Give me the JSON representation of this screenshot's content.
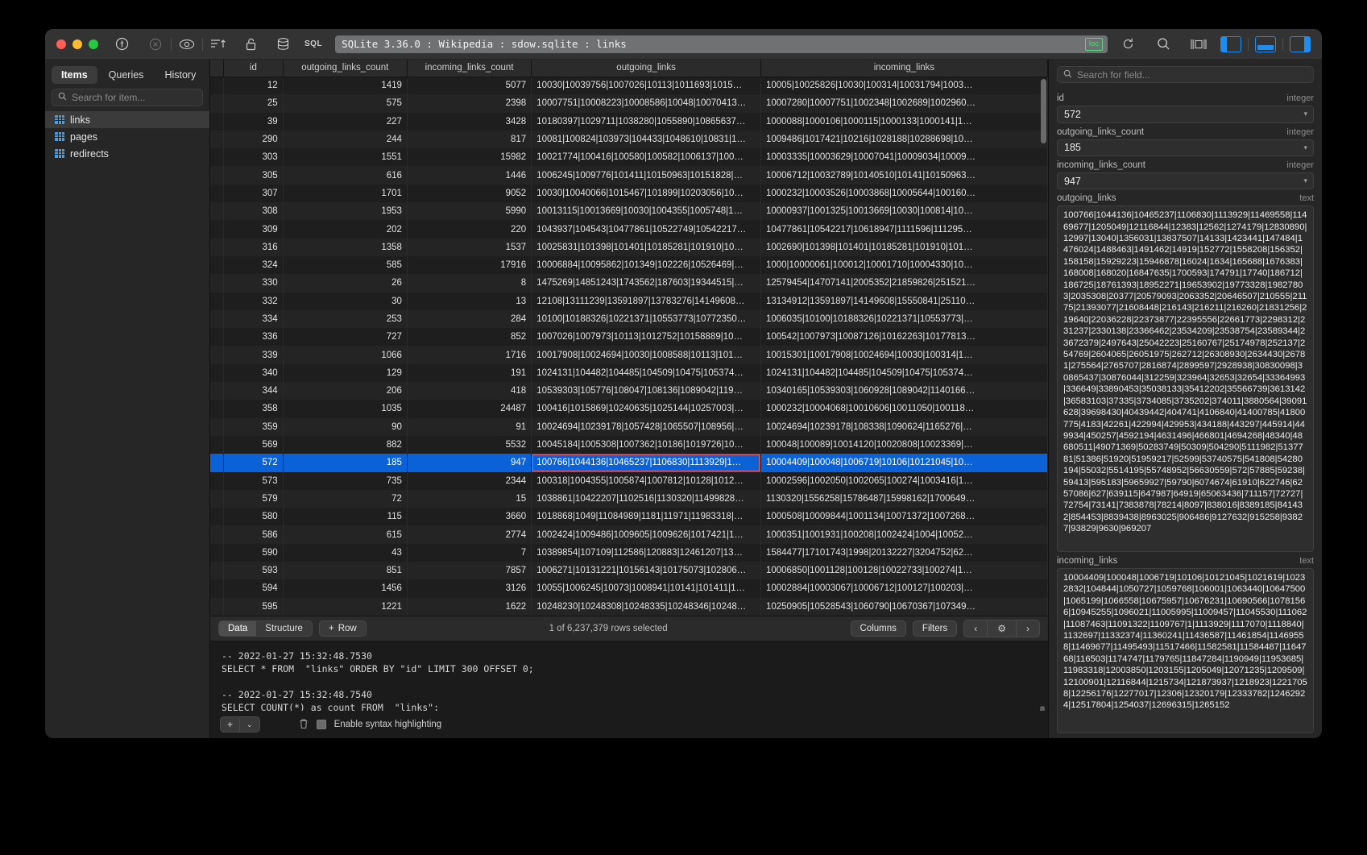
{
  "titlebar": {
    "path": "SQLite 3.36.0 : Wikipedia : sdow.sqlite : links",
    "sql_label": "SQL",
    "loc_badge": "loc",
    "icons": {
      "plug": "plug-icon",
      "stop": "stop-icon",
      "eye": "eye-icon",
      "sort": "sort-ascending-icon",
      "lock": "unlock-icon",
      "database": "database-icon",
      "refresh": "refresh-icon",
      "search": "search-icon",
      "panel": "center-panel-icon",
      "left_panel": "left-panel-icon",
      "bottom_panel": "bottom-panel-icon",
      "right_panel": "right-panel-icon"
    }
  },
  "sidebar": {
    "tabs": [
      {
        "label": "Items",
        "active": true
      },
      {
        "label": "Queries",
        "active": false
      },
      {
        "label": "History",
        "active": false
      }
    ],
    "search_placeholder": "Search for item...",
    "search_value": "",
    "items": [
      {
        "label": "links",
        "selected": true
      },
      {
        "label": "pages",
        "selected": false
      },
      {
        "label": "redirects",
        "selected": false
      }
    ]
  },
  "grid": {
    "columns": [
      "id",
      "outgoing_links_count",
      "incoming_links_count",
      "outgoing_links",
      "incoming_links"
    ],
    "rows": [
      {
        "id": "12",
        "olc": "1419",
        "ilc": "5077",
        "ol": "10030|10039756|1007026|10113|1011693|1015…",
        "il": "10005|10025826|10030|100314|10031794|1003…",
        "selected": false
      },
      {
        "id": "25",
        "olc": "575",
        "ilc": "2398",
        "ol": "10007751|10008223|10008586|10048|10070413…",
        "il": "10007280|10007751|1002348|1002689|1002960…",
        "selected": false
      },
      {
        "id": "39",
        "olc": "227",
        "ilc": "3428",
        "ol": "10180397|1029711|1038280|1055890|10865637…",
        "il": "1000088|1000106|1000115|1000133|1000141|1…",
        "selected": false
      },
      {
        "id": "290",
        "olc": "244",
        "ilc": "817",
        "ol": "10081|100824|103973|104433|1048610|10831|1…",
        "il": "1009486|1017421|10216|1028188|10288698|10…",
        "selected": false
      },
      {
        "id": "303",
        "olc": "1551",
        "ilc": "15982",
        "ol": "10021774|100416|100580|100582|1006137|100…",
        "il": "10003335|10003629|10007041|10009034|10009…",
        "selected": false
      },
      {
        "id": "305",
        "olc": "616",
        "ilc": "1446",
        "ol": "1006245|1009776|101411|10150963|10151828|…",
        "il": "10006712|10032789|10140510|10141|10150963…",
        "selected": false
      },
      {
        "id": "307",
        "olc": "1701",
        "ilc": "9052",
        "ol": "10030|10040066|1015467|101899|10203056|10…",
        "il": "1000232|10003526|10003868|10005644|100160…",
        "selected": false
      },
      {
        "id": "308",
        "olc": "1953",
        "ilc": "5990",
        "ol": "10013115|10013669|10030|1004355|1005748|1…",
        "il": "10000937|1001325|10013669|10030|100814|10…",
        "selected": false
      },
      {
        "id": "309",
        "olc": "202",
        "ilc": "220",
        "ol": "1043937|104543|10477861|10522749|10542217…",
        "il": "10477861|10542217|10618947|1111596|111295…",
        "selected": false
      },
      {
        "id": "316",
        "olc": "1358",
        "ilc": "1537",
        "ol": "10025831|101398|101401|10185281|101910|10…",
        "il": "1002690|101398|101401|10185281|101910|101…",
        "selected": false
      },
      {
        "id": "324",
        "olc": "585",
        "ilc": "17916",
        "ol": "10006884|10095862|101349|102226|10526469|…",
        "il": "1000|10000061|100012|10001710|10004330|10…",
        "selected": false
      },
      {
        "id": "330",
        "olc": "26",
        "ilc": "8",
        "ol": "1475269|14851243|1743562|187603|19344515|…",
        "il": "12579454|14707141|2005352|21859826|251521…",
        "selected": false
      },
      {
        "id": "332",
        "olc": "30",
        "ilc": "13",
        "ol": "12108|13111239|13591897|13783276|14149608…",
        "il": "13134912|13591897|14149608|15550841|25110…",
        "selected": false
      },
      {
        "id": "334",
        "olc": "253",
        "ilc": "284",
        "ol": "10100|10188326|10221371|10553773|10772350…",
        "il": "1006035|10100|10188326|10221371|10553773|…",
        "selected": false
      },
      {
        "id": "336",
        "olc": "727",
        "ilc": "852",
        "ol": "1007026|1007973|10113|1012752|10158889|10…",
        "il": "100542|1007973|10087126|10162263|10177813…",
        "selected": false
      },
      {
        "id": "339",
        "olc": "1066",
        "ilc": "1716",
        "ol": "10017908|10024694|10030|1008588|10113|101…",
        "il": "10015301|10017908|10024694|10030|100314|1…",
        "selected": false
      },
      {
        "id": "340",
        "olc": "129",
        "ilc": "191",
        "ol": "1024131|104482|104485|104509|10475|105374…",
        "il": "1024131|104482|104485|104509|10475|105374…",
        "selected": false
      },
      {
        "id": "344",
        "olc": "206",
        "ilc": "418",
        "ol": "10539303|105776|108047|108136|1089042|119…",
        "il": "10340165|10539303|1060928|1089042|1140166…",
        "selected": false
      },
      {
        "id": "358",
        "olc": "1035",
        "ilc": "24487",
        "ol": "100416|1015869|10240635|1025144|10257003|…",
        "il": "1000232|10004068|10010606|10011050|100118…",
        "selected": false
      },
      {
        "id": "359",
        "olc": "90",
        "ilc": "91",
        "ol": "10024694|10239178|1057428|1065507|108956|…",
        "il": "10024694|10239178|108338|1090624|1165276|…",
        "selected": false
      },
      {
        "id": "569",
        "olc": "882",
        "ilc": "5532",
        "ol": "10045184|1005308|1007362|10186|1019726|10…",
        "il": "100048|100089|10014120|10020808|10023369|…",
        "selected": false
      },
      {
        "id": "572",
        "olc": "185",
        "ilc": "947",
        "ol": "100766|1044136|10465237|1106830|1113929|1…",
        "il": "10004409|100048|1006719|10106|10121045|10…",
        "selected": true
      },
      {
        "id": "573",
        "olc": "735",
        "ilc": "2344",
        "ol": "100318|1004355|1005874|1007812|10128|1012…",
        "il": "10002596|1002050|1002065|100274|1003416|1…",
        "selected": false
      },
      {
        "id": "579",
        "olc": "72",
        "ilc": "15",
        "ol": "1038861|10422207|1102516|1130320|11499828…",
        "il": "1130320|1556258|15786487|15998162|1700649…",
        "selected": false
      },
      {
        "id": "580",
        "olc": "115",
        "ilc": "3660",
        "ol": "1018868|1049|11084989|1181|11971|11983318|…",
        "il": "1000508|10009844|1001134|10071372|1007268…",
        "selected": false
      },
      {
        "id": "586",
        "olc": "615",
        "ilc": "2774",
        "ol": "1002424|1009486|1009605|1009626|1017421|1…",
        "il": "1000351|1001931|100208|1002424|1004|10052…",
        "selected": false
      },
      {
        "id": "590",
        "olc": "43",
        "ilc": "7",
        "ol": "10389854|107109|112586|120883|12461207|13…",
        "il": "1584477|17101743|1998|20132227|3204752|62…",
        "selected": false
      },
      {
        "id": "593",
        "olc": "851",
        "ilc": "7857",
        "ol": "1006271|10131221|10156143|10175073|102806…",
        "il": "10006850|1001128|100128|10022733|100274|1…",
        "selected": false
      },
      {
        "id": "594",
        "olc": "1456",
        "ilc": "3126",
        "ol": "10055|1006245|10073|1008941|10141|101411|1…",
        "il": "10002884|10003067|10006712|100127|100203|…",
        "selected": false
      },
      {
        "id": "595",
        "olc": "1221",
        "ilc": "1622",
        "ol": "10248230|10248308|10248335|10248346|10248…",
        "il": "10250905|10528543|1060790|10670367|107349…",
        "selected": false
      }
    ]
  },
  "grid_toolbar": {
    "data_tab": "Data",
    "structure_tab": "Structure",
    "add_row": "Row",
    "status": "1 of 6,237,379 rows selected",
    "columns_button": "Columns",
    "filters_button": "Filters",
    "prev": "‹",
    "next": "›",
    "gear": "⚙"
  },
  "console": {
    "text": "-- 2022-01-27 15:32:48.7530\nSELECT * FROM  \"links\" ORDER BY \"id\" LIMIT 300 OFFSET 0;\n\n-- 2022-01-27 15:32:48.7540\nSELECT COUNT(*) as count FROM  \"links\";",
    "syntax_label": "Enable syntax highlighting",
    "syntax_checked": true,
    "add_label": "+",
    "add_chevron": "⌄"
  },
  "inspector": {
    "search_placeholder": "Search for field...",
    "search_value": "",
    "fields": [
      {
        "name": "id",
        "type": "integer",
        "value": "572",
        "kind": "select"
      },
      {
        "name": "outgoing_links_count",
        "type": "integer",
        "value": "185",
        "kind": "select"
      },
      {
        "name": "incoming_links_count",
        "type": "integer",
        "value": "947",
        "kind": "select"
      },
      {
        "name": "outgoing_links",
        "type": "text",
        "kind": "textarea",
        "value": "100766|1044136|10465237|1106830|1113929|11469558|11469677|1205049|12116844|12383|12562|1274179|12830890|12997|13040|1356031|13837507|14133|1423441|147484|1476024|1488463|1491462|14919|152772|1558208|156352|158158|15929223|15946878|16024|1634|165688|1676383|168008|168020|16847635|1700593|174791|17740|186712|186725|18761393|18952271|19653902|19773328|19827803|2035308|20377|20579093|2063352|20646507|210555|21175|21393077|21608448|216143|216211|216260|21831256|219640|22036228|22373877|22395556|22661773|2298312|231237|2330138|23366462|23534209|23538754|23589344|23672379|2497643|25042223|25160767|25174978|252137|254769|2604065|26051975|262712|26308930|2634430|26781|275564|2765707|2816874|2899597|2928938|30830098|30865437|30876044|312259|323964|32653|32654|33364993|336649|33890453|35038133|35412202|35566739|3613142|36583103|37335|3734085|3735202|374011|3880564|39091628|39698430|40439442|404741|4106840|41400785|41800775|4183|42261|422994|429953|434188|443297|445914|449934|450257|4592194|4631496|466801|4694268|48340|48680511|49071369|50283749|50309|504290|5111982|5137781|51386|51920|51959217|52599|53740575|541808|54280194|55032|5514195|55748952|56630559|572|57885|59238|59413|595183|59659927|59790|6074674|61910|622746|6257086|627|639115|647987|64919|65063436|711157|72727|72754|73141|7383878|78214|8097|838016|8389185|841432|854453|8839438|8963025|906486|9127632|915258|93827|93829|9630|969207"
      },
      {
        "name": "incoming_links",
        "type": "text",
        "kind": "textarea",
        "value": "10004409|100048|1006719|10106|10121045|1021619|10232832|104844|1050727|1059768|106001|1063440|10647500|1065199|1066558|10675957|10676231|10690566|10781566|10945255|1096021|11005995|11009457|11045530|111062|11087463|11091322|1109767|1|1113929|1117070|1118840|1132697|11332374|11360241|11436587|11461854|11469558|11469677|11495493|11517466|11582581|11584487|1164768|116503|1174747|1179765|11847284|1190949|11953685|11983318|12003850|1203155|1205049|12071235|1209509|12100901|12116844|1215734|121873937|1218923|12217058|12256176|12277017|12306|12320179|12333782|12462924|12517804|1254037|12696315|1265152"
      }
    ]
  }
}
